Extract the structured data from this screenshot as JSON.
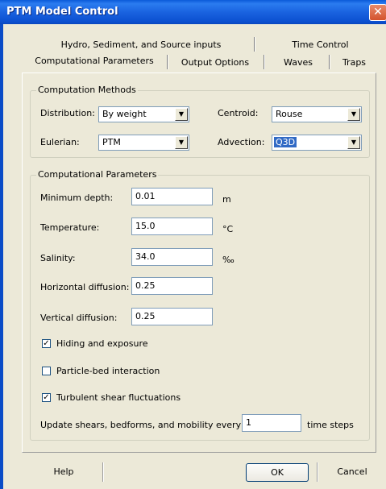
{
  "window": {
    "title": "PTM Model Control"
  },
  "tabs": {
    "row1": [
      "Hydro, Sediment, and Source inputs",
      "Time Control"
    ],
    "row2": [
      "Computational Parameters",
      "Output Options",
      "Waves",
      "Traps"
    ],
    "active": "Computational Parameters"
  },
  "methods": {
    "title": "Computation Methods",
    "distribution_label": "Distribution:",
    "distribution_value": "By weight",
    "centroid_label": "Centroid:",
    "centroid_value": "Rouse",
    "eulerian_label": "Eulerian:",
    "eulerian_value": "PTM",
    "advection_label": "Advection:",
    "advection_value": "Q3D"
  },
  "params": {
    "title": "Computational Parameters",
    "min_depth_label": "Minimum depth:",
    "min_depth_value": "0.01",
    "min_depth_unit": "m",
    "temperature_label": "Temperature:",
    "temperature_value": "15.0",
    "temperature_unit": "°C",
    "salinity_label": "Salinity:",
    "salinity_value": "34.0",
    "salinity_unit": "‰",
    "hdiff_label": "Horizontal diffusion:",
    "hdiff_value": "0.25",
    "vdiff_label": "Vertical diffusion:",
    "vdiff_value": "0.25",
    "hiding_label": "Hiding and exposure",
    "hiding_checked": true,
    "particle_bed_label": "Particle-bed interaction",
    "particle_bed_checked": false,
    "turbulent_label": "Turbulent shear fluctuations",
    "turbulent_checked": true,
    "update_label": "Update shears, bedforms, and mobility every",
    "update_value": "1",
    "update_unit": "time steps"
  },
  "buttons": {
    "help": "Help",
    "ok": "OK",
    "cancel": "Cancel"
  }
}
